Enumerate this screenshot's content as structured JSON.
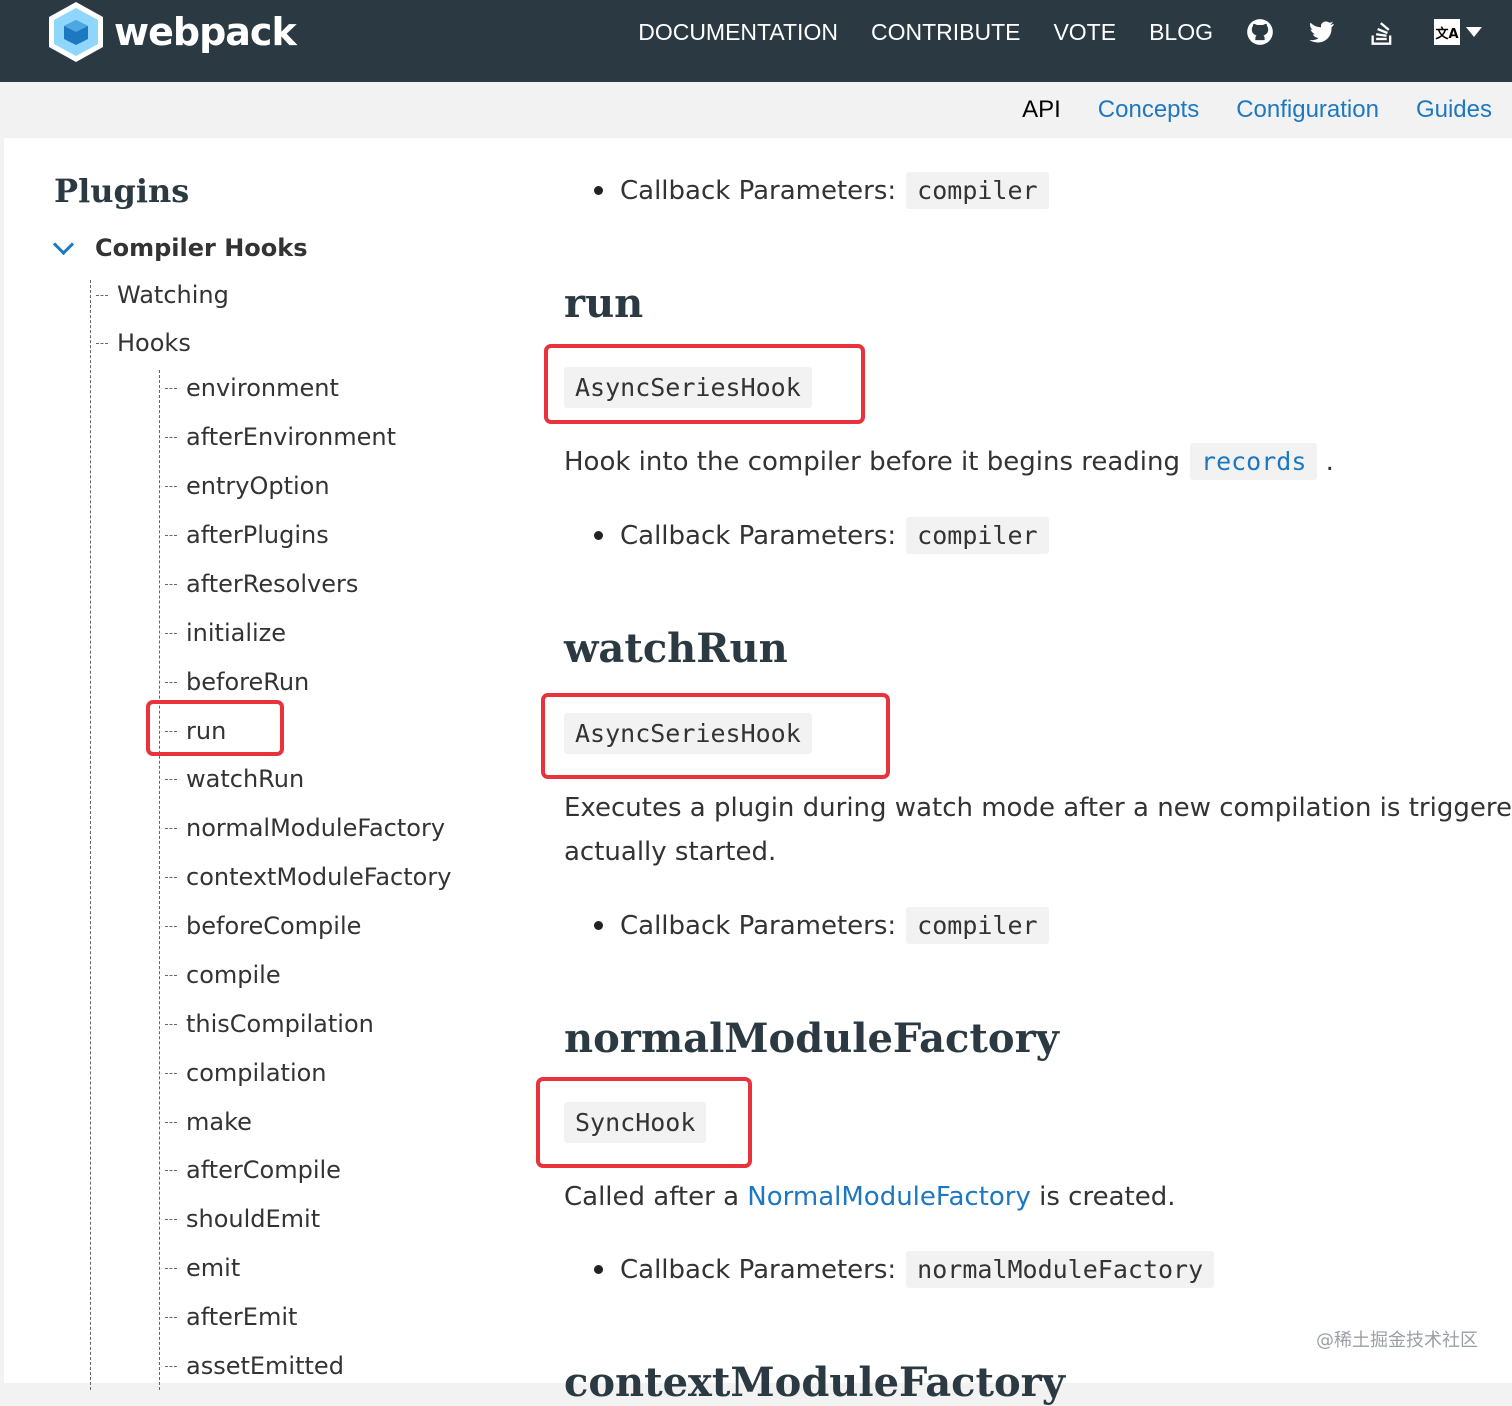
{
  "header": {
    "logo_text": "webpack",
    "nav": [
      "DOCUMENTATION",
      "CONTRIBUTE",
      "VOTE",
      "BLOG"
    ],
    "icons": [
      "github-icon",
      "twitter-icon",
      "stackoverflow-icon",
      "language-icon"
    ],
    "lang_badge": "文A"
  },
  "subnav": {
    "items": [
      "API",
      "Concepts",
      "Configuration",
      "Guides"
    ],
    "active": "API"
  },
  "sidebar": {
    "title": "Plugins",
    "section": "Compiler Hooks",
    "level1": [
      "Watching",
      "Hooks"
    ],
    "hooks": [
      "environment",
      "afterEnvironment",
      "entryOption",
      "afterPlugins",
      "afterResolvers",
      "initialize",
      "beforeRun",
      "run",
      "watchRun",
      "normalModuleFactory",
      "contextModuleFactory",
      "beforeCompile",
      "compile",
      "thisCompilation",
      "compilation",
      "make",
      "afterCompile",
      "shouldEmit",
      "emit",
      "afterEmit",
      "assetEmitted"
    ]
  },
  "content": {
    "top_param_label": "Callback Parameters:",
    "top_param_value": "compiler",
    "sections": [
      {
        "title": "run",
        "hook_type": "AsyncSeriesHook",
        "desc_before": "Hook into the compiler before it begins reading",
        "desc_code": "records",
        "desc_after": ".",
        "param_label": "Callback Parameters:",
        "param_value": "compiler"
      },
      {
        "title": "watchRun",
        "hook_type": "AsyncSeriesHook",
        "desc_line1": "Executes a plugin during watch mode after a new compilation is triggered but",
        "desc_line2": "actually started.",
        "param_label": "Callback Parameters:",
        "param_value": "compiler"
      },
      {
        "title": "normalModuleFactory",
        "hook_type": "SyncHook",
        "desc_before": "Called after a",
        "desc_link": "NormalModuleFactory",
        "desc_after": "is created.",
        "param_label": "Callback Parameters:",
        "param_value": "normalModuleFactory"
      },
      {
        "title": "contextModuleFactory"
      }
    ]
  },
  "watermark": "@稀土掘金技术社区"
}
